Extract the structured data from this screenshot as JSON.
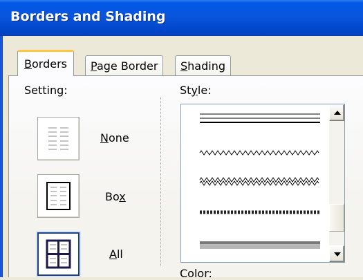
{
  "window": {
    "title": "Borders and Shading"
  },
  "tabs": [
    {
      "label_ul": "B",
      "label_rest": "orders",
      "active": true
    },
    {
      "label_ul": "P",
      "label_rest": "age Border",
      "active": false
    },
    {
      "label_ul": "S",
      "label_rest": "hading",
      "active": false
    }
  ],
  "setting": {
    "heading": "Setting:",
    "options": [
      {
        "label_pre": "",
        "label_ul": "N",
        "label_post": "one",
        "selected": false
      },
      {
        "label_pre": "Bo",
        "label_ul": "x",
        "label_post": "",
        "selected": false
      },
      {
        "label_pre": "",
        "label_ul": "A",
        "label_post": "ll",
        "selected": true
      }
    ]
  },
  "style": {
    "heading_pre": "St",
    "heading_ul": "y",
    "heading_post": "le:",
    "items": [
      "double-line",
      "wavy-line",
      "double-wavy-line",
      "thick-thin-dashed-line",
      "gray-3d-line"
    ],
    "scroll_position": 0.75
  },
  "color": {
    "heading": "Color:"
  },
  "colors": {
    "title_bar": "#0058e6",
    "tab_highlight": "#ffc83c",
    "selection": "#1c3f8a"
  }
}
